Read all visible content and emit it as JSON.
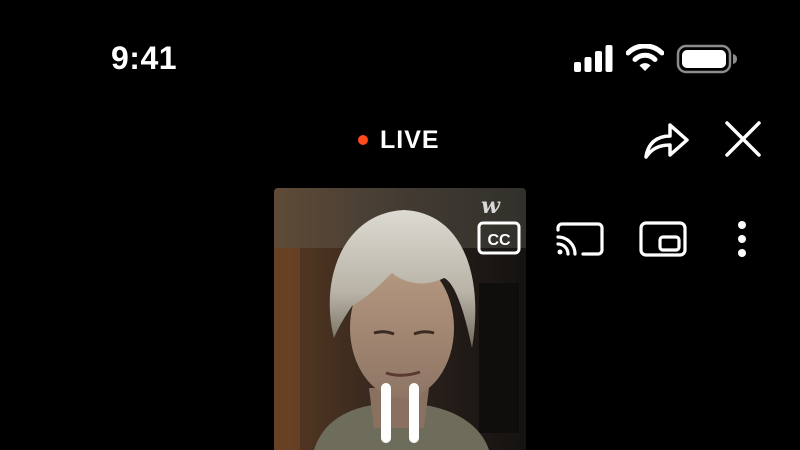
{
  "status_bar": {
    "time": "9:41",
    "icons": [
      "cellular-signal-icon",
      "wifi-icon",
      "battery-icon"
    ]
  },
  "header": {
    "live_label": "LIVE",
    "live_dot_color": "#ff4a1c"
  },
  "actions": {
    "share": "share-icon",
    "close": "close-icon"
  },
  "player_controls": {
    "cc_label": "CC",
    "icons": [
      "cast-icon",
      "picture-in-picture-icon",
      "more-vertical-icon"
    ]
  },
  "video": {
    "watermark": "w",
    "state": "playing",
    "control": "pause-icon"
  }
}
